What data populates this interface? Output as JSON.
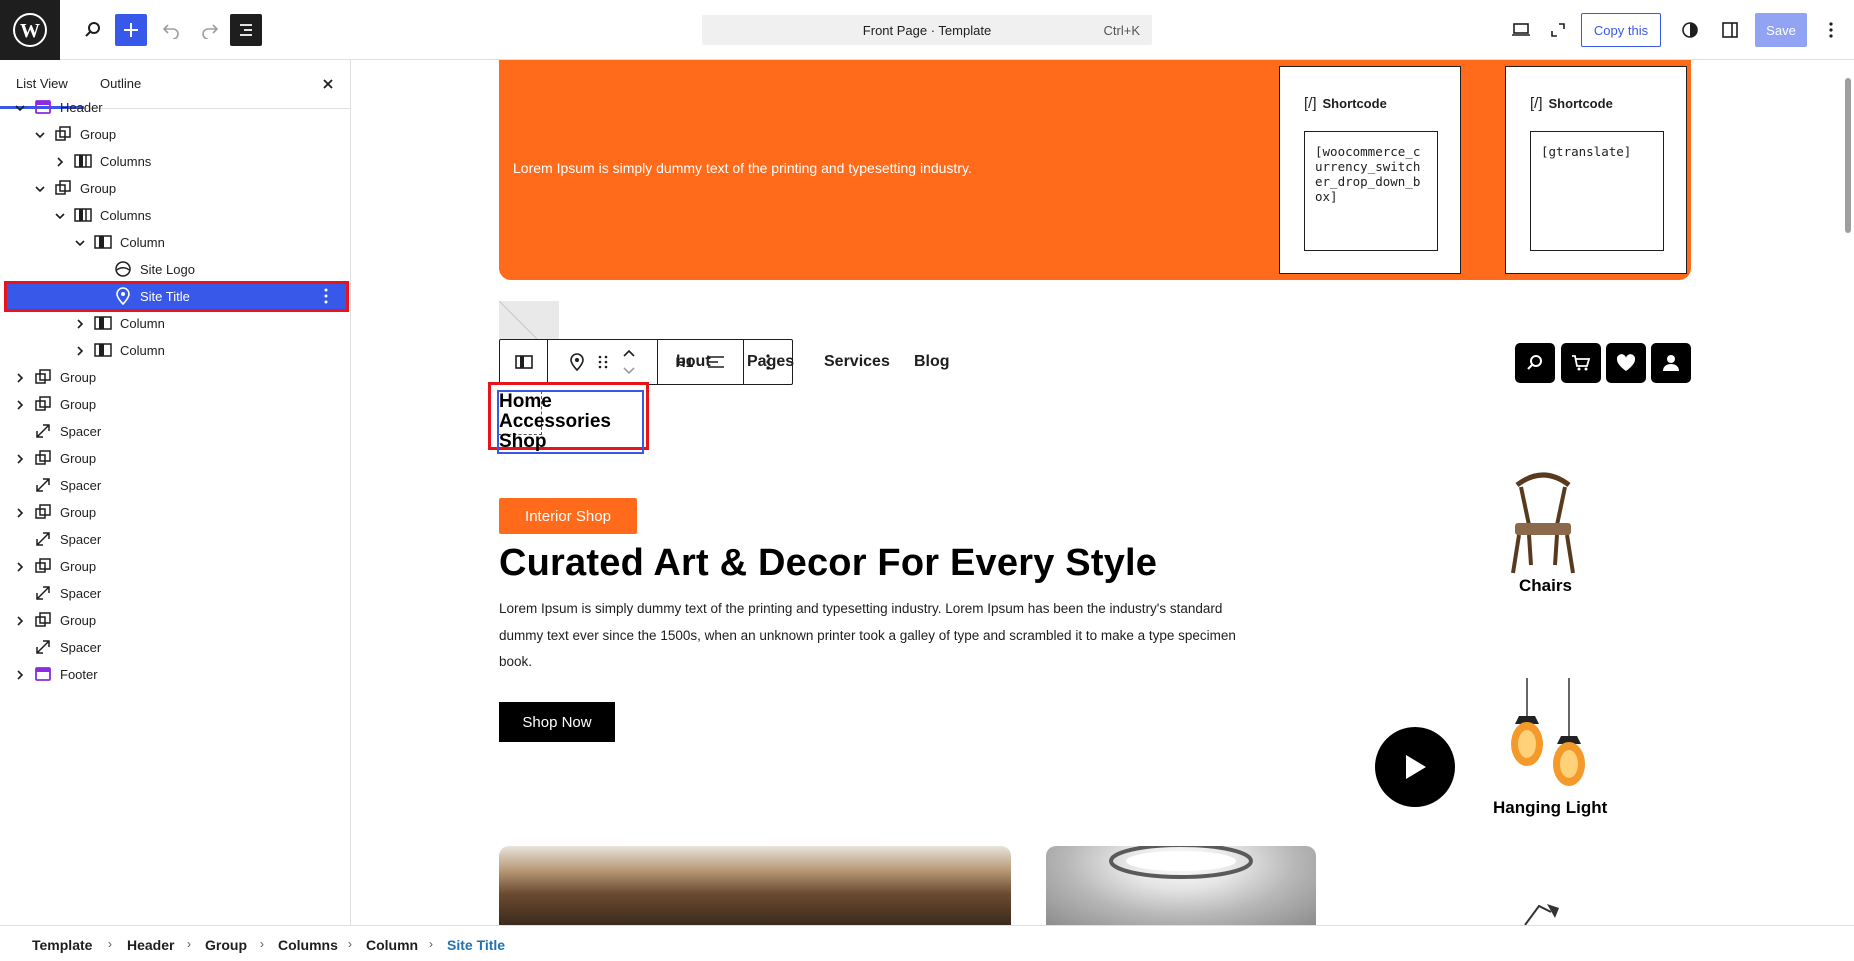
{
  "topbar": {
    "command_title": "Front Page · Template",
    "command_shortcut": "Ctrl+K",
    "copy_label": "Copy this",
    "save_label": "Save"
  },
  "sidebar": {
    "tabs": [
      "List View",
      "Outline"
    ],
    "tree": [
      {
        "label": "Header",
        "icon": "template-part-icon",
        "chevron": "down"
      },
      {
        "label": "Group",
        "icon": "group-icon",
        "chevron": "down"
      },
      {
        "label": "Columns",
        "icon": "columns-icon",
        "chevron": "right"
      },
      {
        "label": "Group",
        "icon": "group-icon",
        "chevron": "down"
      },
      {
        "label": "Columns",
        "icon": "columns-icon",
        "chevron": "down"
      },
      {
        "label": "Column",
        "icon": "column-icon",
        "chevron": "down"
      },
      {
        "label": "Site Logo",
        "icon": "site-logo-icon",
        "chevron": ""
      },
      {
        "label": "Site Title",
        "icon": "map-marker-icon",
        "chevron": ""
      },
      {
        "label": "Column",
        "icon": "column-icon",
        "chevron": "right"
      },
      {
        "label": "Column",
        "icon": "column-icon",
        "chevron": "right"
      },
      {
        "label": "Group",
        "icon": "group-icon",
        "chevron": "right"
      },
      {
        "label": "Group",
        "icon": "group-icon",
        "chevron": "right"
      },
      {
        "label": "Spacer",
        "icon": "spacer-icon",
        "chevron": ""
      },
      {
        "label": "Group",
        "icon": "group-icon",
        "chevron": "right"
      },
      {
        "label": "Spacer",
        "icon": "spacer-icon",
        "chevron": ""
      },
      {
        "label": "Group",
        "icon": "group-icon",
        "chevron": "right"
      },
      {
        "label": "Spacer",
        "icon": "spacer-icon",
        "chevron": ""
      },
      {
        "label": "Group",
        "icon": "group-icon",
        "chevron": "right"
      },
      {
        "label": "Spacer",
        "icon": "spacer-icon",
        "chevron": ""
      },
      {
        "label": "Group",
        "icon": "group-icon",
        "chevron": "right"
      },
      {
        "label": "Spacer",
        "icon": "spacer-icon",
        "chevron": ""
      },
      {
        "label": "Footer",
        "icon": "template-part-icon",
        "chevron": "right"
      }
    ]
  },
  "canvas": {
    "banner_text": "Lorem Ipsum is simply dummy text of the printing and typesetting industry.",
    "shortcodes": [
      {
        "title": "Shortcode",
        "bracket": "[/]",
        "value": "[woocommerce_currency_switcher_drop_down_box]"
      },
      {
        "title": "Shortcode",
        "bracket": "[/]",
        "value": "[gtranslate]"
      }
    ],
    "toolbar_heading": "H1",
    "nav": [
      "bout",
      "Pages",
      "Services",
      "Blog"
    ],
    "site_title": "Home Accessories Shop",
    "interior_label": "Interior Shop",
    "hero_title": "Curated Art & Decor For Every Style",
    "hero_text": "Lorem Ipsum is simply dummy text of the printing and typesetting industry. Lorem Ipsum has been the industry's standard dummy text ever since the 1500s, when an unknown printer took a galley of type and scrambled it to make a type specimen book.",
    "shop_now": "Shop Now",
    "products": [
      "Chairs",
      "Hanging Light"
    ]
  },
  "breadcrumb": [
    "Template",
    "Header",
    "Group",
    "Columns",
    "Column",
    "Site Title"
  ],
  "colors": {
    "accent": "#3858e9",
    "orange": "#ff6b1a",
    "highlight": "#e8131b",
    "dark": "#1e1e1e"
  }
}
